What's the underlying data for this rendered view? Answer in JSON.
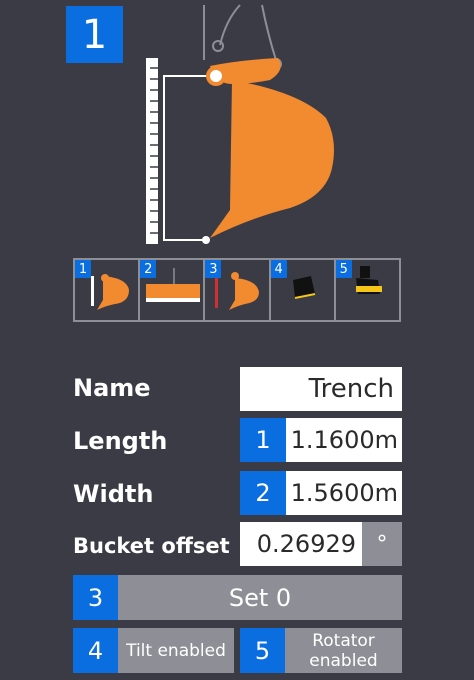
{
  "header": {
    "step_number": "1"
  },
  "thumbnails": [
    {
      "number": "1"
    },
    {
      "number": "2"
    },
    {
      "number": "3"
    },
    {
      "number": "4"
    },
    {
      "number": "5"
    }
  ],
  "form": {
    "name_label": "Name",
    "name_value": "Trench",
    "length_label": "Length",
    "length_step": "1",
    "length_value": "1.1600m",
    "width_label": "Width",
    "width_step": "2",
    "width_value": "1.5600m",
    "bucket_offset_label": "Bucket offset",
    "bucket_offset_value": "0.26929",
    "bucket_offset_unit": "°"
  },
  "actions": {
    "set0_step": "3",
    "set0_label": "Set 0",
    "tilt_step": "4",
    "tilt_label": "Tilt enabled",
    "rotator_step": "5",
    "rotator_label": "Rotator enabled"
  },
  "colors": {
    "background": "#3b3b45",
    "accent_blue": "#0a6ee0",
    "bucket_orange": "#f28a30",
    "button_gray": "#8e8e96"
  }
}
